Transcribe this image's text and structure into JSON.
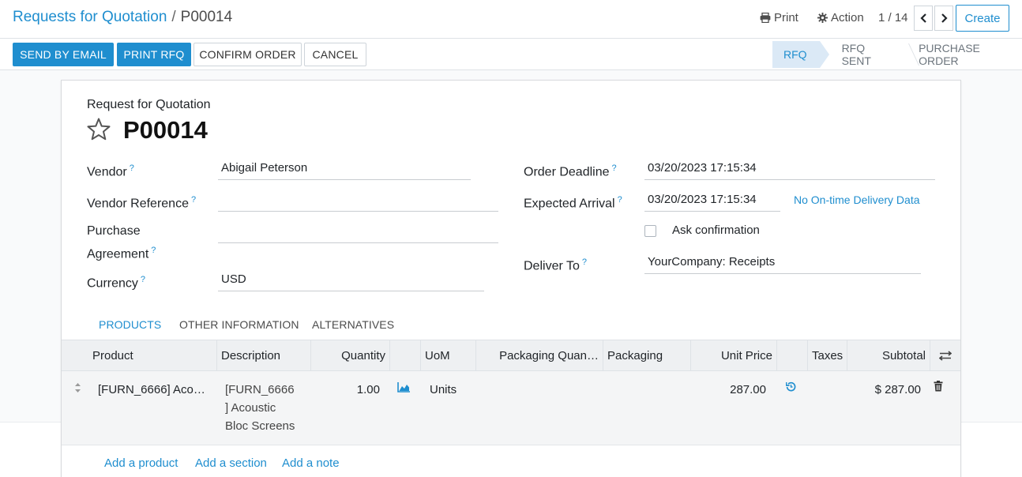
{
  "breadcrumb": {
    "parent": "Requests for Quotation",
    "separator": "/",
    "current": "P00014"
  },
  "toolbar": {
    "print_label": "Print",
    "action_label": "Action",
    "pager": "1 / 14",
    "create_label": "Create"
  },
  "status_buttons": {
    "send_email": "SEND BY EMAIL",
    "print_rfq": "PRINT RFQ",
    "confirm": "CONFIRM ORDER",
    "cancel": "CANCEL"
  },
  "stages": {
    "rfq": "RFQ",
    "rfq_sent": "RFQ SENT",
    "purchase_order": "PURCHASE ORDER",
    "active": "RFQ"
  },
  "form": {
    "type_label": "Request for Quotation",
    "name": "P00014",
    "vendor_label": "Vendor",
    "vendor_value": "Abigail Peterson",
    "vendor_ref_label": "Vendor Reference",
    "vendor_ref_value": "",
    "agreement_label_1": "Purchase",
    "agreement_label_2": "Agreement",
    "agreement_value": "",
    "currency_label": "Currency",
    "currency_value": "USD",
    "deadline_label": "Order Deadline",
    "deadline_value": "03/20/2023 17:15:34",
    "arrival_label": "Expected Arrival",
    "arrival_value": "03/20/2023 17:15:34",
    "ontime_link": "No On-time Delivery Data",
    "ask_confirmation_label": "Ask confirmation",
    "ask_confirmation_checked": false,
    "deliver_to_label": "Deliver To",
    "deliver_to_value": "YourCompany: Receipts",
    "help_marker": "?"
  },
  "tabs": {
    "products": "PRODUCTS",
    "other_info": "OTHER INFORMATION",
    "alternatives": "ALTERNATIVES",
    "active": "PRODUCTS"
  },
  "table": {
    "headers": {
      "product": "Product",
      "description": "Description",
      "quantity": "Quantity",
      "uom": "UoM",
      "packaging_qty": "Packaging Quan…",
      "packaging": "Packaging",
      "unit_price": "Unit Price",
      "taxes": "Taxes",
      "subtotal": "Subtotal"
    },
    "rows": [
      {
        "product": "[FURN_6666] Aco…",
        "description_lines": [
          "[FURN_6666",
          "] Acoustic",
          "Bloc Screens"
        ],
        "quantity": "1.00",
        "uom": "Units",
        "packaging_qty": "",
        "packaging": "",
        "unit_price": "287.00",
        "taxes": "",
        "subtotal": "$ 287.00"
      }
    ],
    "add_product": "Add a product",
    "add_section": "Add a section",
    "add_note": "Add a note"
  },
  "colors": {
    "accent": "#1f8ecf",
    "stage_active_bg": "#dbe9f6"
  },
  "icons": [
    "printer-icon",
    "gear-icon",
    "chevron-left-icon",
    "chevron-right-icon",
    "star-icon",
    "forecast-chart-icon",
    "reset-price-icon",
    "trash-icon",
    "drag-handle-icon",
    "optional-columns-icon"
  ]
}
